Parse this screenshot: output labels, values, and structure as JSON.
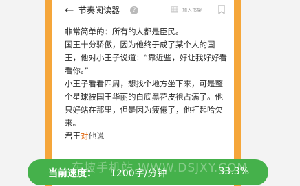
{
  "header": {
    "title": "节奏阅读器",
    "shelf_label": "加入书架"
  },
  "content": {
    "lines": [
      "非常简单的：所有的人都是臣民。",
      "国王十分骄傲，因为他终于成了某个人的国王，他对小王子说道：“靠近些，好让我好好看看你。”",
      "小王子看看四周，想找个地方坐下来，可是整个星球被国王华丽的白底黑花皮袍占满了。他只好站在那里，但是因为疲倦了，他打起哈欠来。"
    ],
    "last_line": {
      "read": "君王",
      "current": "对",
      "unread": "他说"
    }
  },
  "progress": {
    "speed_label": "当前速度：",
    "speed_value": "1200字/分钟",
    "percent": "33.3%",
    "watermark": "东坡手机站 WWW.DSJXY.COM"
  },
  "colors": {
    "phone": "#f5a63a",
    "progress": "#45b14b",
    "highlight": "#e36a12"
  }
}
